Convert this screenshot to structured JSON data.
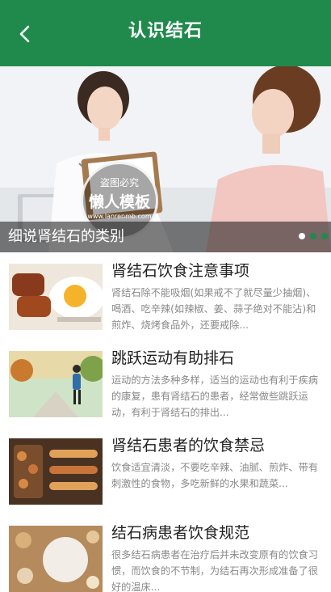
{
  "header": {
    "title": "认识结石",
    "back_icon": "chevron-left-icon",
    "background": "#1f8a4c"
  },
  "banner": {
    "caption": "细说肾结石的类别",
    "watermark": {
      "top": "盗图必究",
      "main": "懒人模板",
      "sub": "www.lanrenmb.com"
    },
    "slides": 3,
    "active_slide": 1
  },
  "news": [
    {
      "title": "肾结石饮食注意事项",
      "desc": "肾结石除不能吸烟(如果戒不了就尽量少抽烟)、喝酒、吃辛辣(如辣椒、姜、蒜子绝对不能沾)和煎炸、烧烤食品外，还要戒除..."
    },
    {
      "title": "跳跃运动有助排石",
      "desc": "运动的方法多种多样，适当的运动也有利于疾病的康复，患有肾结石的患者，经常做些跳跃运动，有利于肾结石的排出..."
    },
    {
      "title": "肾结石患者的饮食禁忌",
      "desc": "饮食适宜清淡，不要吃辛辣、油腻、煎炸、带有刺激性的食物，多吃新鲜的水果和蔬菜..."
    },
    {
      "title": "结石病患者饮食规范",
      "desc": "很多结石病患者在治疗后并未改变原有的饮食习惯，而饮食的不节制，为结石再次形成准备了很好的温床..."
    }
  ]
}
